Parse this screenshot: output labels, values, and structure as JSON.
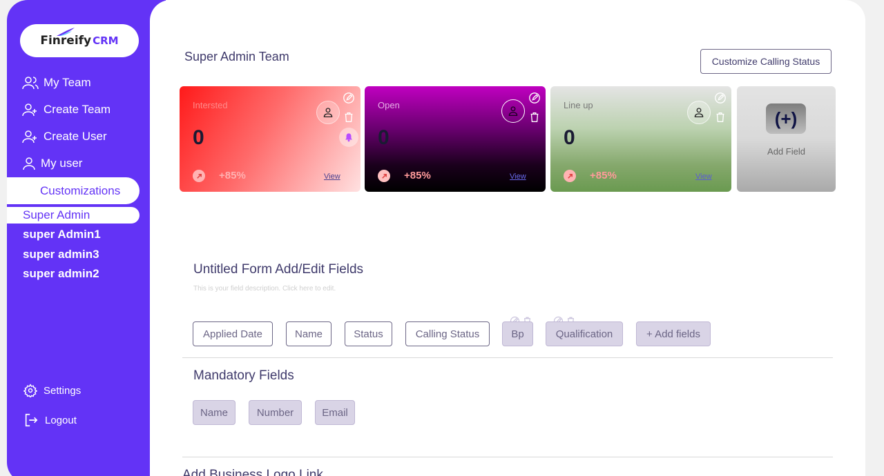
{
  "brand": {
    "name": "Finreify",
    "suffix": "CRM"
  },
  "sidebar": {
    "items": [
      {
        "label": "My Team"
      },
      {
        "label": "Create Team"
      },
      {
        "label": "Create User"
      },
      {
        "label": "My user"
      }
    ],
    "active_label": "Customizations",
    "sub_items": [
      "Super Admin",
      "super Admin1",
      "super admin3",
      "super admin2"
    ],
    "settings_label": "Settings",
    "logout_label": "Logout"
  },
  "header": {
    "title": "Super Admin Team",
    "customize_button": "Customize Calling Status"
  },
  "cards": [
    {
      "label": "Intersted",
      "count": "0",
      "percent": "+85%",
      "view": "View"
    },
    {
      "label": "Open",
      "count": "0",
      "percent": "+85%",
      "view": "View"
    },
    {
      "label": "Line up",
      "count": "0",
      "percent": "+85%",
      "view": "View"
    }
  ],
  "add_card": {
    "plus": "(+)",
    "label": "Add Field"
  },
  "form": {
    "title": "Untitled Form Add/Edit Fields",
    "description": "This is your field description. Click here to edit.",
    "fields": [
      "Applied Date",
      "Name",
      "Status",
      "Calling Status",
      "Bp",
      "Qualification",
      "+ Add fields"
    ]
  },
  "mandatory": {
    "title": "Mandatory Fields",
    "fields": [
      "Name",
      "Number",
      "Email"
    ]
  },
  "logo_link": {
    "title": "Add Business Logo Link"
  },
  "colors": {
    "accent": "#6333f6",
    "text": "#3f3a6b",
    "chip": "#d9d4e6"
  }
}
